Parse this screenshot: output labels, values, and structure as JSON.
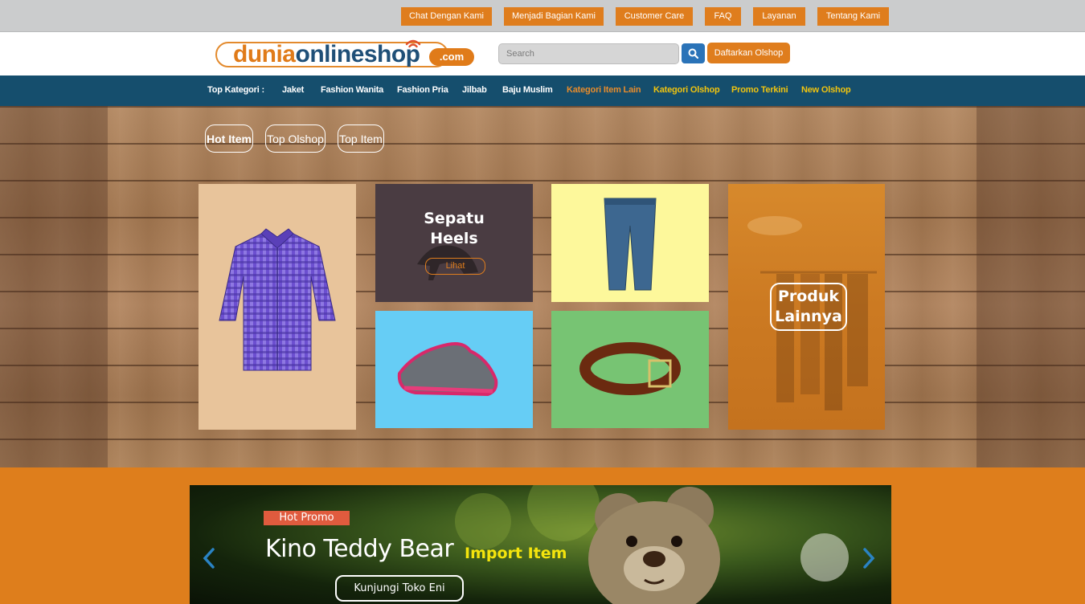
{
  "utility_nav": [
    {
      "label": "Chat Dengan Kami"
    },
    {
      "label": "Menjadi Bagian Kami"
    },
    {
      "label": "Customer Care"
    },
    {
      "label": "FAQ"
    },
    {
      "label": "Layanan"
    },
    {
      "label": "Tentang Kami"
    }
  ],
  "logo": {
    "part1": "dunia",
    "part2": "onlineshop",
    "suffix": ".com"
  },
  "search": {
    "placeholder": "Search"
  },
  "register_button": "Daftarkan Olshop",
  "category_nav": {
    "heading": "Top Kategori :",
    "items": [
      {
        "label": "Jaket"
      },
      {
        "label": "Fashion Wanita"
      },
      {
        "label": "Fashion Pria"
      },
      {
        "label": "Jilbab"
      },
      {
        "label": "Baju Muslim"
      },
      {
        "label": "Kategori Item Lain"
      },
      {
        "label": "Kategori Olshop"
      },
      {
        "label": "Promo Terkini"
      },
      {
        "label": "New Olshop"
      }
    ]
  },
  "colors": {
    "accent_orange": "#df7d1d",
    "nav_blue": "#154e6d",
    "highlight_yellow": "#f1c40f"
  },
  "hero_tabs": [
    {
      "label": "Hot Item",
      "active": true
    },
    {
      "label": "Top Olshop",
      "active": false
    },
    {
      "label": "Top Item",
      "active": false
    }
  ],
  "product_tiles": {
    "shirt": {
      "image": "checked-shirt-image"
    },
    "heels": {
      "title_line1": "Sepatu",
      "title_line2": "Heels",
      "button": "Lihat"
    },
    "jeans": {
      "image": "jeans-image"
    },
    "sneakers": {
      "image": "sneakers-image"
    },
    "belt": {
      "image": "belt-image"
    },
    "more": {
      "label_line1": "Produk",
      "label_line2": "Lainnya"
    }
  },
  "promo_banner": {
    "badge": "Hot Promo",
    "title": "Kino Teddy Bear",
    "subtitle": "Import Item",
    "button": "Kunjungi Toko Eni"
  }
}
